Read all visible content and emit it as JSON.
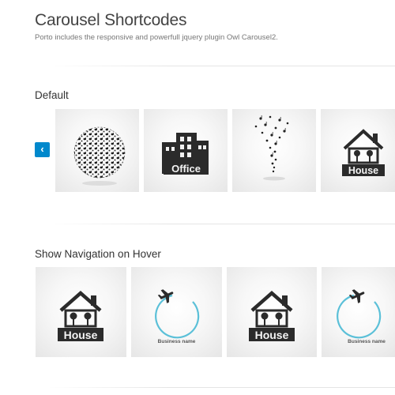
{
  "header": {
    "title": "Carousel Shortcodes",
    "subtitle": "Porto includes the responsive and powerfull jquery plugin Owl Carousel2."
  },
  "sections": [
    {
      "heading": "Default",
      "nav": {
        "prev_icon": "chevron-left-icon",
        "prev_glyph": "‹",
        "color": "#0088cc"
      },
      "items": [
        {
          "icon": "music-notes-globe-icon"
        },
        {
          "icon": "office-building-icon",
          "label": "Office"
        },
        {
          "icon": "music-notes-tornado-icon"
        },
        {
          "icon": "house-icon",
          "label": "House"
        }
      ]
    },
    {
      "heading": "Show Navigation on Hover",
      "items": [
        {
          "icon": "house-icon",
          "label": "House"
        },
        {
          "icon": "airplane-circle-icon",
          "label": "Business name"
        },
        {
          "icon": "house-icon",
          "label": "House"
        },
        {
          "icon": "airplane-circle-icon",
          "label": "Business name"
        }
      ]
    }
  ]
}
